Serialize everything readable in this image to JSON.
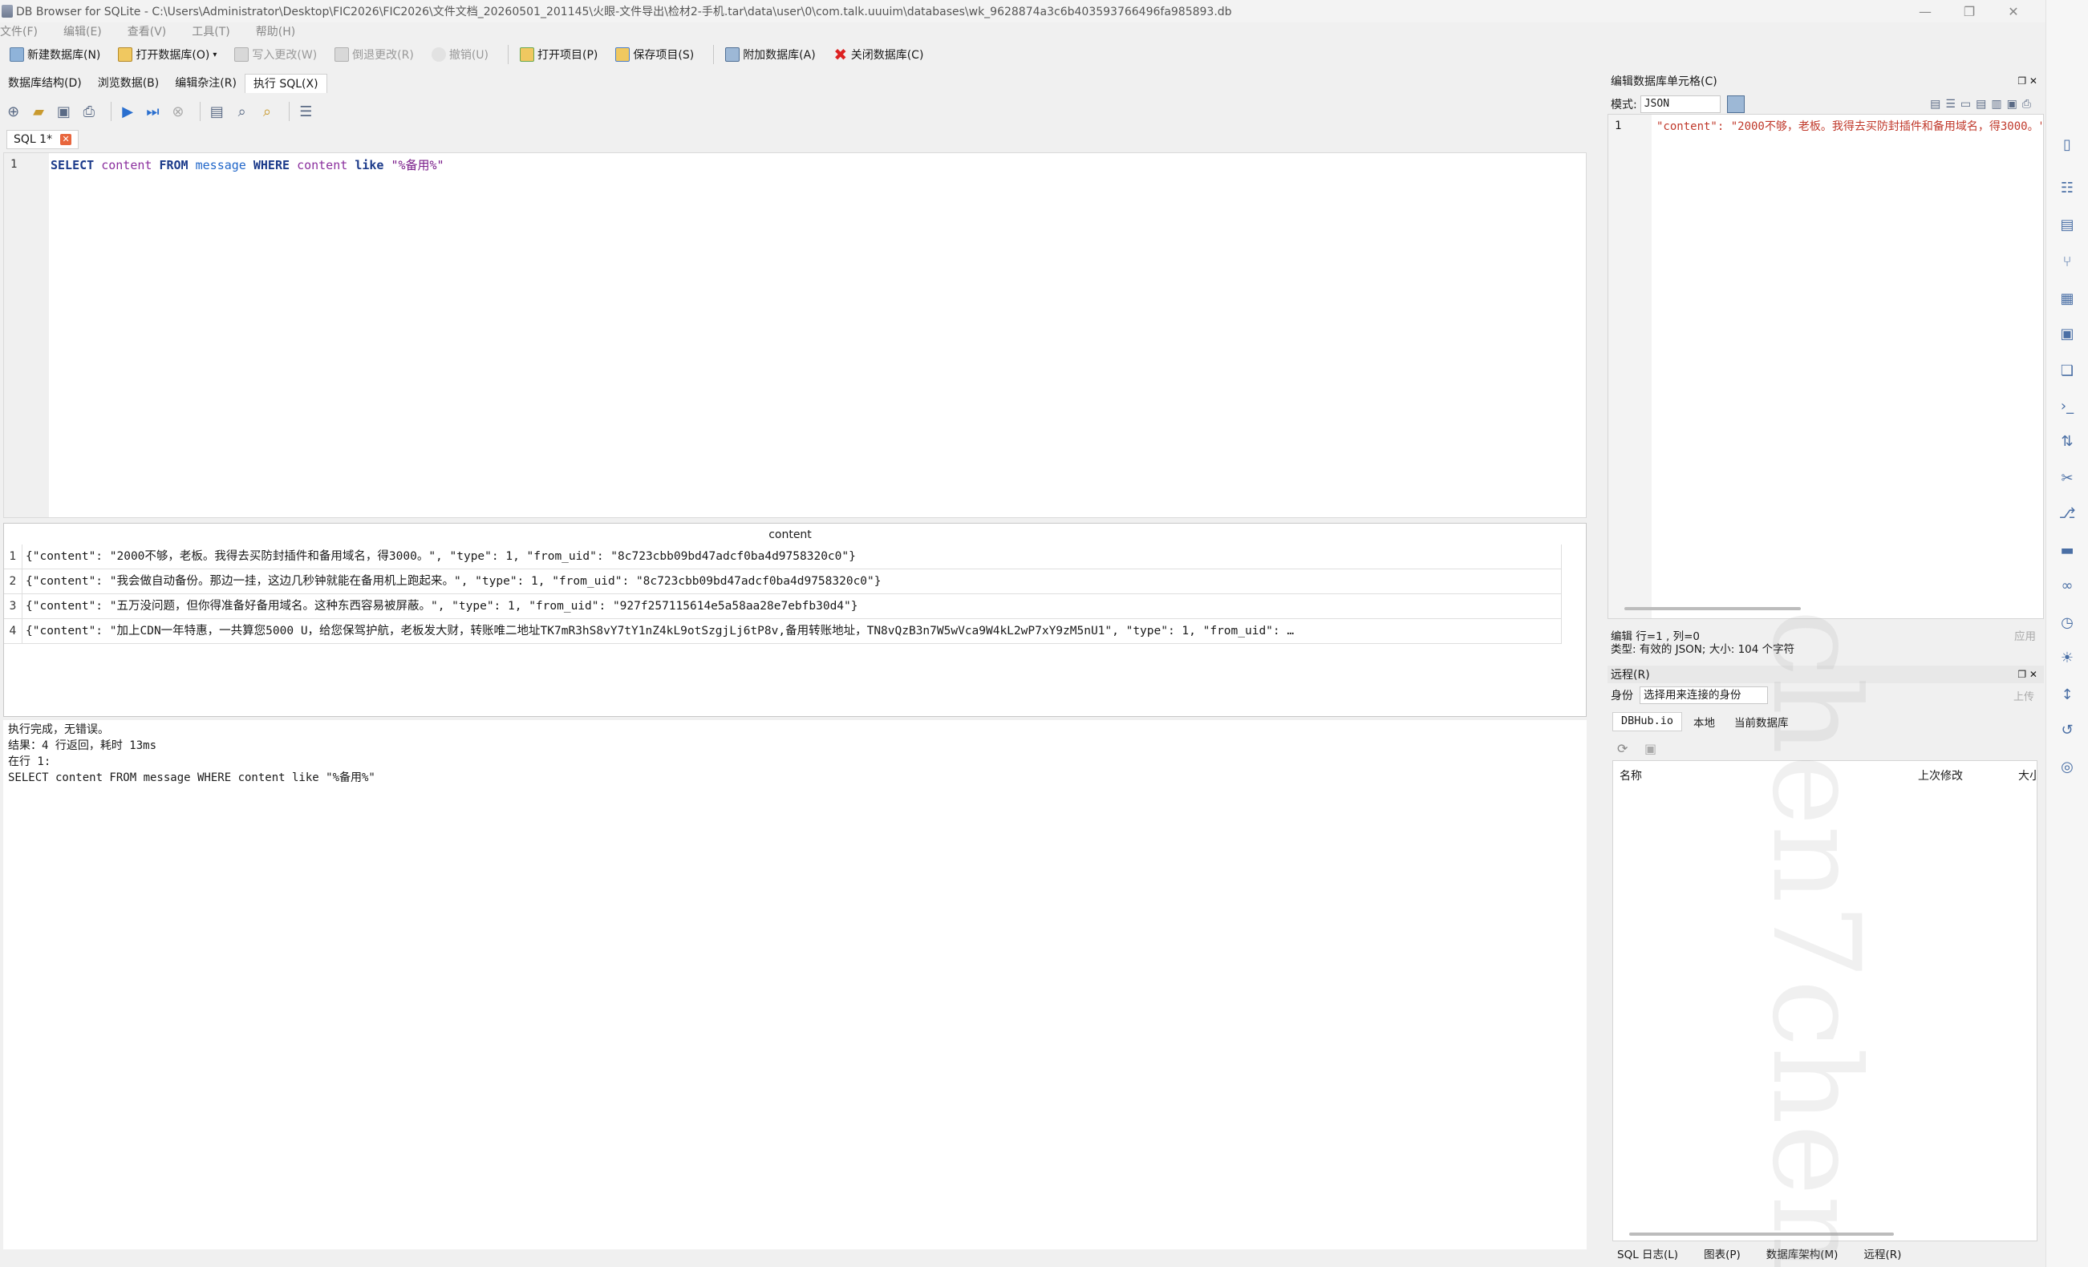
{
  "window": {
    "title": "DB Browser for SQLite - C:\\Users\\Administrator\\Desktop\\FIC2026\\FIC2026\\文件文档_20260501_201145\\火眼-文件导出\\检材2-手机.tar\\data\\user\\0\\com.talk.uuuim\\databases\\wk_9628874a3c6b403593766496fa985893.db",
    "minimize": "—",
    "maximize": "❐",
    "close": "✕"
  },
  "menu": [
    "文件(F)",
    "编辑(E)",
    "查看(V)",
    "工具(T)",
    "帮助(H)"
  ],
  "toolbar": {
    "new_db": "新建数据库(N)",
    "open_db": "打开数据库(O)",
    "write_changes": "写入更改(W)",
    "revert_changes": "倒退更改(R)",
    "undo": "撤销(U)",
    "open_project": "打开项目(P)",
    "save_project": "保存项目(S)",
    "attach_db": "附加数据库(A)",
    "close_db": "关闭数据库(C)"
  },
  "tabs": [
    "数据库结构(D)",
    "浏览数据(B)",
    "编辑杂注(R)",
    "执行 SQL(X)"
  ],
  "sql_tab": {
    "label": "SQL 1*"
  },
  "editor": {
    "line": "1",
    "tokens": [
      "SELECT",
      "content",
      "FROM",
      "message",
      "WHERE",
      "content",
      "like",
      "\"%备用%\""
    ]
  },
  "results": {
    "column": "content",
    "rows": [
      {
        "n": "1",
        "value": "{\"content\": \"2000不够，老板。我得去买防封插件和备用域名，得3000。\", \"type\": 1, \"from_uid\": \"8c723cbb09bd47adcf0ba4d9758320c0\"}"
      },
      {
        "n": "2",
        "value": "{\"content\": \"我会做自动备份。那边一挂，这边几秒钟就能在备用机上跑起来。\", \"type\": 1, \"from_uid\": \"8c723cbb09bd47adcf0ba4d9758320c0\"}"
      },
      {
        "n": "3",
        "value": "{\"content\": \"五万没问题，但你得准备好备用域名。这种东西容易被屏蔽。\", \"type\": 1, \"from_uid\": \"927f257115614e5a58aa28e7ebfb30d4\"}"
      },
      {
        "n": "4",
        "value": "{\"content\": \"加上CDN一年特惠，一共算您5000 U，给您保驾护航，老板发大财，转账唯二地址TK7mR3hS8vY7tY1nZ4kL9otSzgjLj6tP8v,备用转账地址，TN8vQzB3n7W5wVca9W4kL2wP7xY9zM5nU1\", \"type\": 1, \"from_uid\": …"
      }
    ]
  },
  "messages": [
    "执行完成，无错误。",
    "结果：4 行返回，耗时 13ms",
    "在行 1:",
    "SELECT content FROM message WHERE content like \"%备用%\""
  ],
  "cell_editor": {
    "title": "编辑数据库单元格(C)",
    "mode_label": "模式:",
    "mode_value": "JSON",
    "line": "1",
    "content": "\"content\": \"2000不够，老板。我得去买防封插件和备用域名，得3000。\"",
    "status_line1": "编辑 行=1 , 列=0",
    "status_line2": "类型: 有效的 JSON; 大小: 104 个字符",
    "apply": "应用"
  },
  "remote": {
    "title": "远程(R)",
    "identity_label": "身份",
    "identity_value": "选择用来连接的身份",
    "upload": "上传",
    "tabs": [
      "DBHub.io",
      "本地",
      "当前数据库"
    ],
    "col_name": "名称",
    "col_modified": "上次修改",
    "col_size": "大小"
  },
  "bottom_tabs": [
    "SQL 日志(L)",
    "图表(P)",
    "数据库架构(M)",
    "远程(R)"
  ],
  "watermark": "chen7chen",
  "colors": {
    "keyword": "#1b3a8a",
    "identifier": "#8b2f9e",
    "table": "#2066c9",
    "string": "#7a1d8a",
    "accent": "#4a6fa5"
  }
}
